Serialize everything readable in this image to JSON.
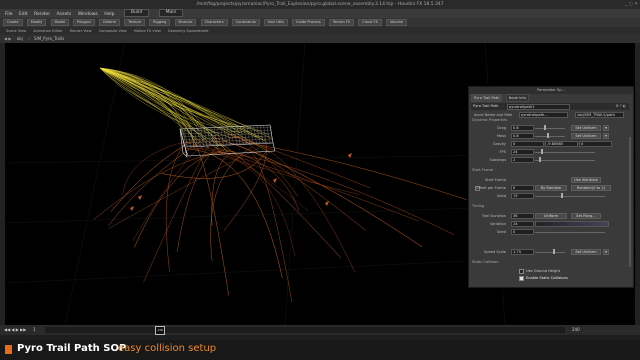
{
  "window": {
    "title": "/mnt/fsg/projects/pyromaniac/Pyro_Trail_Explosion/pyro.global.scene_assembly.3.14.hip - Houdini FX 18.5.347"
  },
  "menu": {
    "items": [
      "File",
      "Edit",
      "Render",
      "Assets",
      "Windows",
      "Help"
    ],
    "desktop": "Build",
    "main": "Main"
  },
  "shelf": {
    "items": [
      "Create",
      "Modify",
      "Model",
      "Polygon",
      "Deform",
      "Texture",
      "Rigging",
      "Muscles",
      "Characters",
      "Constraints",
      "Hair Utils",
      "Guide Process",
      "Terrain FX",
      "Cloud FX",
      "Volume"
    ]
  },
  "pane_tabs": {
    "items": [
      "Scene View",
      "Animation Editor",
      "Render View",
      "Composite View",
      "Motion FX View",
      "Geometry Spreadsheet"
    ]
  },
  "path": {
    "obj": "obj",
    "node": "SIM_Pyro_Trails"
  },
  "panel": {
    "title": "Parameter Sp...",
    "tabs": [
      "Pyro Trail Path",
      "Node Info"
    ],
    "node_type": "Pyro Trail Path",
    "node_name": "pyrotrailpath2",
    "accel_name_label": "Accel Name and Path",
    "accel_name_value": "pyrotrailpath...",
    "accel_path_value": "/obj/SIM_TRAILS/path",
    "dynamic_props": "Dynamic Properties",
    "drag_label": "Drag",
    "drag_value": "0.6",
    "drag_btn": "Set Uniform",
    "mass_label": "Mass",
    "mass_value": "0.8",
    "mass_btn": "Set Uniform",
    "gravity_label": "Gravity",
    "gravity_values": [
      "0",
      "-9.80665",
      "0"
    ],
    "fps_label": "FPS",
    "fps_value": "24",
    "substeps_label": "Substeps",
    "substeps_value": "2",
    "start_frame_section": "Start Frame",
    "start_frame_label": "Start Frame",
    "start_frame_btn": "Use Attribute",
    "offset_label": "Offset per Frame",
    "offset_value": "0",
    "offset_btn": "By Random",
    "offset_dist": "Random(0 to 1)",
    "seed_label": "Seed",
    "seed_value": "19",
    "timing_section": "Timing",
    "trail_duration_label": "Trail Duration",
    "trail_duration_value": "36",
    "trail_duration_mode": "Uniform",
    "trail_duration_btn": "Set Rang...",
    "variation_label": "Variation",
    "variation_value": "24",
    "seed2_label": "Seed",
    "seed2_value": "0",
    "speed_scale_label": "Speed Scale",
    "speed_scale_value": "1.75",
    "speed_scale_btn": "Set Uniform",
    "static_collision_section": "Static Collision",
    "use_ground_plane": "Use Ground Height",
    "enable_static": "Enable Static Collisions"
  },
  "timeline": {
    "current_frame": "136",
    "start": "1",
    "end": "240"
  },
  "caption": {
    "title": "Pyro Trail Path SOP",
    "subtitle": "easy collision setup"
  },
  "colors": {
    "accent": "#e86d1a",
    "trail_yellow": "#f1e03a",
    "trail_orange": "#d96a1e",
    "box_wire": "#dcdcdc"
  }
}
